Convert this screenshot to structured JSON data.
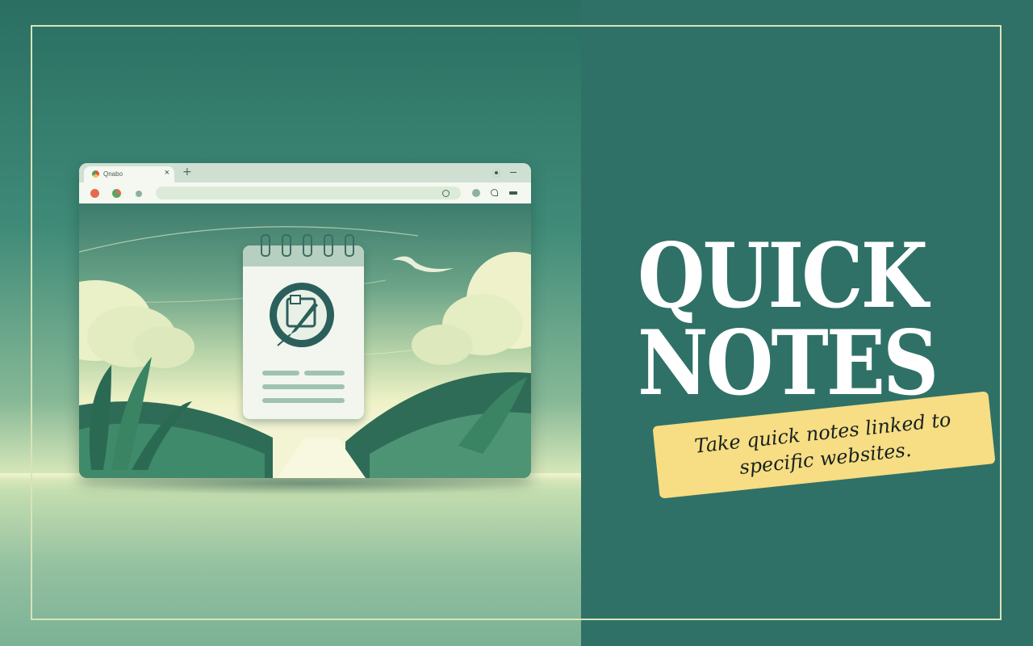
{
  "colors": {
    "background": "#2f7167",
    "frame": "#d9e3b8",
    "title": "#ffffff",
    "tagline_bg": "#f7dd83",
    "tagline_text": "#16211f"
  },
  "browser": {
    "tab_title": "Qnabo",
    "tab_close": "×",
    "new_tab": "+"
  },
  "heading": {
    "line1": "QUICK",
    "line2": "NOTES"
  },
  "tagline": {
    "line1": "Take quick notes linked to",
    "line2": "specific websites."
  }
}
